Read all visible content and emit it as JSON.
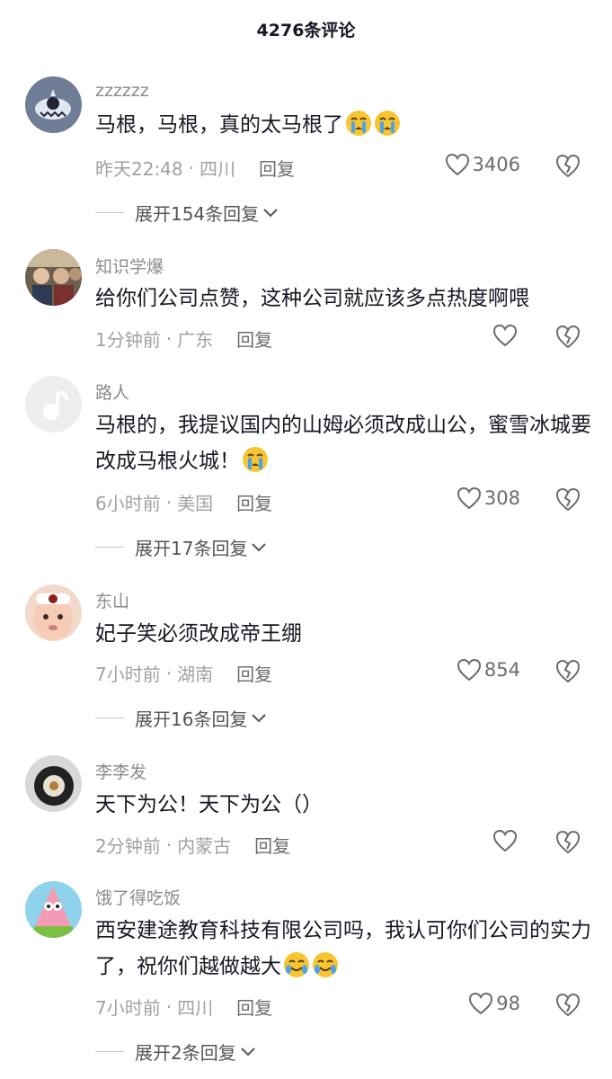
{
  "header": {
    "title": "4276条评论"
  },
  "comments": [
    {
      "username": "zzzzzz",
      "text": "马根，马根，真的太马根了",
      "time": "昨天22:48",
      "location": "四川",
      "reply": "回复",
      "likes": "3406",
      "expand": "展开154条回复"
    },
    {
      "username": "知识学爆",
      "text": "给你们公司点赞，这种公司就应该多点热度啊喂",
      "time": "1分钟前",
      "location": "广东",
      "reply": "回复",
      "likes": "",
      "expand": ""
    },
    {
      "username": "路人",
      "text": "马根的，我提议国内的山姆必须改成山公，蜜雪冰城要改成马根火城！",
      "time": "6小时前",
      "location": "美国",
      "reply": "回复",
      "likes": "308",
      "expand": "展开17条回复"
    },
    {
      "username": "东山",
      "text": "妃子笑必须改成帝王绷",
      "time": "7小时前",
      "location": "湖南",
      "reply": "回复",
      "likes": "854",
      "expand": "展开16条回复"
    },
    {
      "username": "李李发",
      "text": "天下为公！天下为公（）",
      "time": "2分钟前",
      "location": "内蒙古",
      "reply": "回复",
      "likes": "",
      "expand": ""
    },
    {
      "username": "饿了得吃饭",
      "text": "西安建途教育科技有限公司吗，我认可你们公司的实力了，祝你们越做越大",
      "time": "7小时前",
      "location": "四川",
      "reply": "回复",
      "likes": "98",
      "expand": "展开2条回复"
    }
  ]
}
